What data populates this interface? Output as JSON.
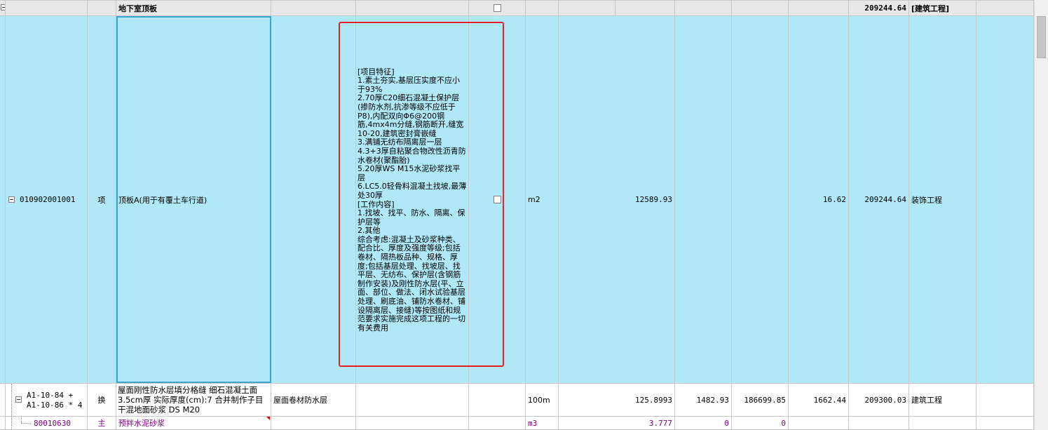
{
  "grid": {
    "group_row": {
      "name": "地下室顶板",
      "total": "209244.64",
      "category": "[建筑工程]"
    },
    "item_row": {
      "code": "010902001001",
      "type": "项",
      "name": "顶板A(用于有覆土车行道)",
      "description": "[项目特征]\n1.素土夯实,基层压实度不应小于93%\n2.70厚C20细石混凝土保护层(掺防水剂,抗渗等级不应低于P8),内配双向Φ6@200钢筋,4mx4m分缝,钢筋断开,缝宽10-20,建筑密封膏嵌缝\n3.满铺无纺布隔离层一层\n4.3+3厚自粘聚合物改性沥青防水卷材(聚酯胎)\n5.20厚WS M15水泥砂浆找平层\n6.LC5.0轻骨料混凝土找坡,最薄处30厚\n[工作内容]\n1.找坡、找平、防水、隔离、保护层等\n2.其他\n综合考虑:混凝土及砂浆种类、配合比、厚度及强度等级;包括卷材、隔热板品种、规格、厚度;包括基层处理、找坡层、找平层、无纺布、保护层(含钢筋制作安装)及刚性防水层(平、立面、部位、做法、闭水试验基层处理、刷底油、铺防水卷材、铺设隔离层、接缝)等按图纸和规范要求实施完成这项工程的一切有关费用",
      "unit": "m2",
      "quantity": "12589.93",
      "unit_price": "16.62",
      "total": "209244.64",
      "category": "装饰工程"
    },
    "sub_row": {
      "code": "A1-10-84 +\nA1-10-86 * 4",
      "type": "换",
      "name": "屋面刚性防水层填分格缝 细石混凝土面3.5cm厚  实际厚度(cm):7  合并制作子目 干混地面砂浆 DS M20",
      "spec": "屋面卷材防水层",
      "unit": "100m",
      "quantity": "125.8993",
      "price_a": "1482.93",
      "price_b": "186699.85",
      "unit_price": "1662.44",
      "total": "209300.03",
      "category": "建筑工程"
    },
    "material_row": {
      "code": "80010630",
      "type": "主",
      "name": "预拌水泥砂浆",
      "unit": "m3",
      "quantity": "3.777",
      "price_a": "0",
      "price_b": "0"
    }
  }
}
